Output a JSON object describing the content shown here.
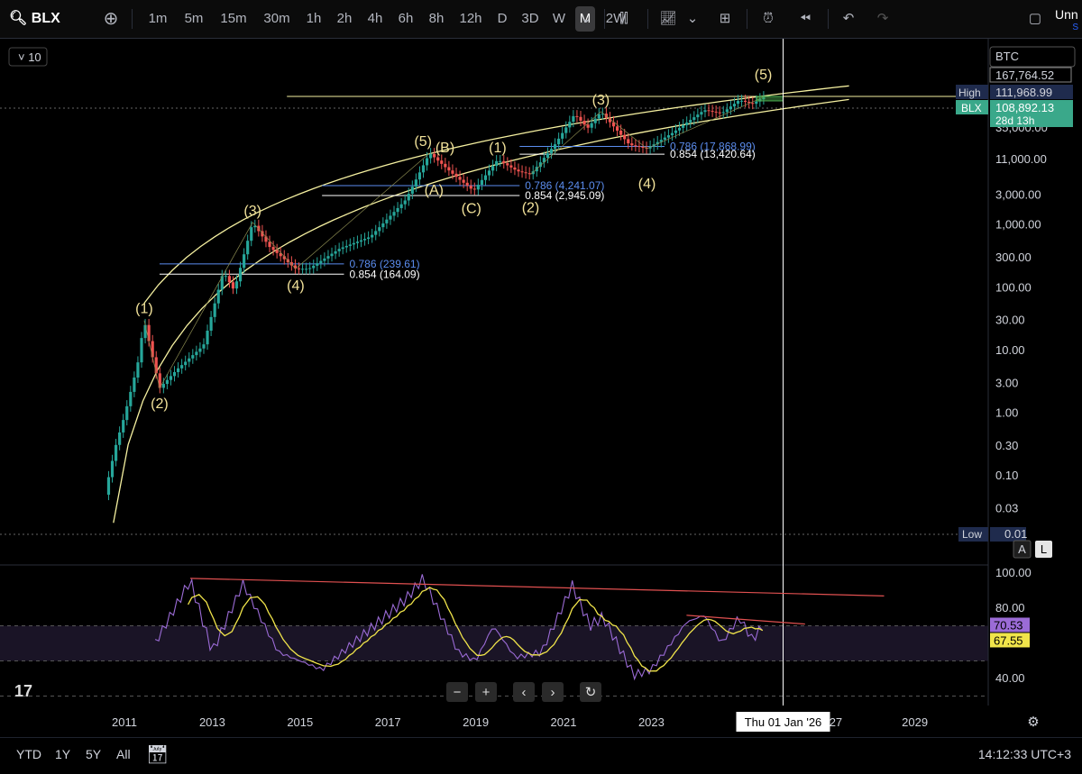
{
  "toolbar": {
    "symbol": "BLX",
    "intervals": [
      "1m",
      "5m",
      "15m",
      "30m",
      "1h",
      "2h",
      "4h",
      "6h",
      "8h",
      "12h",
      "D",
      "3D",
      "W",
      "M",
      "2W"
    ],
    "active_interval": "M",
    "right_label": "Unn",
    "right_sublabel": "S"
  },
  "currency": "BTC",
  "legend_value": "10",
  "bottombar": {
    "ranges": [
      "YTD",
      "1Y",
      "5Y",
      "All"
    ],
    "clock": "14:12:33 UTC+3"
  },
  "price_axis": {
    "labels": [
      "35,000.00",
      "11,000.00",
      "3,000.00",
      "1,000.00",
      "300.00",
      "100.00",
      "30.00",
      "10.00",
      "3.00",
      "1.00",
      "0.30",
      "0.10",
      "0.03"
    ],
    "top_value": "167,764.52",
    "high_label": "High",
    "high_value": "111,968.99",
    "blx_label": "BLX",
    "blx_value": "108,892.13",
    "countdown": "28d 13h",
    "low_label": "Low",
    "low_value": "0.01",
    "btn_auto": "A",
    "btn_log": "L"
  },
  "rsi_axis": {
    "labels": [
      "100.00",
      "80.00",
      "40.00"
    ],
    "rsi_value": "70.53",
    "ma_value": "67.55"
  },
  "time_axis": {
    "labels": [
      "2011",
      "2013",
      "2015",
      "2017",
      "2019",
      "2021",
      "2023",
      "20",
      "27",
      "2029"
    ],
    "crosshair_label": "Thu 01 Jan '26"
  },
  "colors": {
    "up": "#26a69a",
    "down": "#ef5350",
    "wave_text": "#f2e29a",
    "channel": "#f5f0a0",
    "fib_786": "#5b8def",
    "fib_854": "#ffffff",
    "rsi": "#9b6bd6",
    "rsi_ma": "#f0e44a",
    "trend": "#e05050"
  },
  "chart_data": {
    "type": "candlestick",
    "scale": "log",
    "y_range": [
      0.01,
      167764.52
    ],
    "x_range": [
      2010.5,
      2029.7
    ],
    "price_path": [
      [
        2010.55,
        0.05
      ],
      [
        2010.8,
        0.3
      ],
      [
        2011.0,
        0.9
      ],
      [
        2011.3,
        6
      ],
      [
        2011.45,
        30
      ],
      [
        2011.8,
        2.5
      ],
      [
        2012.2,
        5
      ],
      [
        2012.8,
        12
      ],
      [
        2013.25,
        180
      ],
      [
        2013.5,
        90
      ],
      [
        2013.92,
        1100
      ],
      [
        2014.3,
        450
      ],
      [
        2014.9,
        200
      ],
      [
        2015.2,
        200
      ],
      [
        2015.9,
        420
      ],
      [
        2016.6,
        650
      ],
      [
        2017.4,
        2500
      ],
      [
        2017.95,
        14000
      ],
      [
        2018.5,
        6300
      ],
      [
        2018.95,
        3500
      ],
      [
        2019.5,
        11000
      ],
      [
        2019.95,
        7200
      ],
      [
        2020.25,
        6400
      ],
      [
        2020.8,
        19000
      ],
      [
        2021.25,
        58000
      ],
      [
        2021.55,
        35000
      ],
      [
        2021.85,
        64000
      ],
      [
        2022.5,
        19000
      ],
      [
        2022.9,
        16500
      ],
      [
        2023.5,
        30000
      ],
      [
        2024.2,
        68000
      ],
      [
        2024.6,
        60000
      ],
      [
        2025.0,
        98000
      ],
      [
        2025.3,
        85000
      ],
      [
        2025.55,
        108892
      ]
    ],
    "wave_labels": [
      {
        "text": "(1)",
        "x": 2011.45,
        "y": 30,
        "pos": "above"
      },
      {
        "text": "(2)",
        "x": 2011.8,
        "y": 2.5,
        "pos": "below"
      },
      {
        "text": "(3)",
        "x": 2013.92,
        "y": 1100,
        "pos": "above"
      },
      {
        "text": "(4)",
        "x": 2014.9,
        "y": 190,
        "pos": "below"
      },
      {
        "text": "(5)",
        "x": 2017.8,
        "y": 14000,
        "pos": "above"
      },
      {
        "text": "(B)",
        "x": 2018.3,
        "y": 11000,
        "pos": "above"
      },
      {
        "text": "(A)",
        "x": 2018.05,
        "y": 6300,
        "pos": "below"
      },
      {
        "text": "(C)",
        "x": 2018.9,
        "y": 3200,
        "pos": "below"
      },
      {
        "text": "(1)",
        "x": 2019.5,
        "y": 11000,
        "pos": "above"
      },
      {
        "text": "(2)",
        "x": 2020.25,
        "y": 3300,
        "pos": "below"
      },
      {
        "text": "(3)",
        "x": 2021.85,
        "y": 64000,
        "pos": "above"
      },
      {
        "text": "(4)",
        "x": 2022.9,
        "y": 8000,
        "pos": "below"
      },
      {
        "text": "(5)",
        "x": 2025.55,
        "y": 160000,
        "pos": "above"
      }
    ],
    "fib_levels": [
      {
        "label": "0.786 (239.61)",
        "value": 239.61,
        "x_start": 2011.8,
        "x_end": 2016.0,
        "ratio": "0.786"
      },
      {
        "label": "0.854 (164.09)",
        "value": 164.09,
        "x_start": 2011.8,
        "x_end": 2016.0,
        "ratio": "0.854"
      },
      {
        "label": "0.786 (4,241.07)",
        "value": 4241.07,
        "x_start": 2015.5,
        "x_end": 2020.0,
        "ratio": "0.786"
      },
      {
        "label": "0.854 (2,945.09)",
        "value": 2945.09,
        "x_start": 2015.5,
        "x_end": 2020.0,
        "ratio": "0.854"
      },
      {
        "label": "0.786 (17,868.99)",
        "value": 17868.99,
        "x_start": 2020.0,
        "x_end": 2023.3,
        "ratio": "0.786"
      },
      {
        "label": "0.854 (13,420.64)",
        "value": 13420.64,
        "x_start": 2020.0,
        "x_end": 2023.3,
        "ratio": "0.854"
      }
    ],
    "high_line": {
      "value": 111968.99,
      "x_start": 2014.7
    },
    "rsi": {
      "y_range": [
        28,
        100
      ],
      "overbought": 70,
      "oversold": 50,
      "current": 70.53,
      "ma_current": 67.55,
      "trendlines": [
        {
          "x1": 2012.5,
          "y1": 97,
          "x2": 2028.3,
          "y2": 87
        },
        {
          "x1": 2023.8,
          "y1": 76,
          "x2": 2026.5,
          "y2": 71
        }
      ]
    },
    "crosshair_x": 2026.0
  }
}
